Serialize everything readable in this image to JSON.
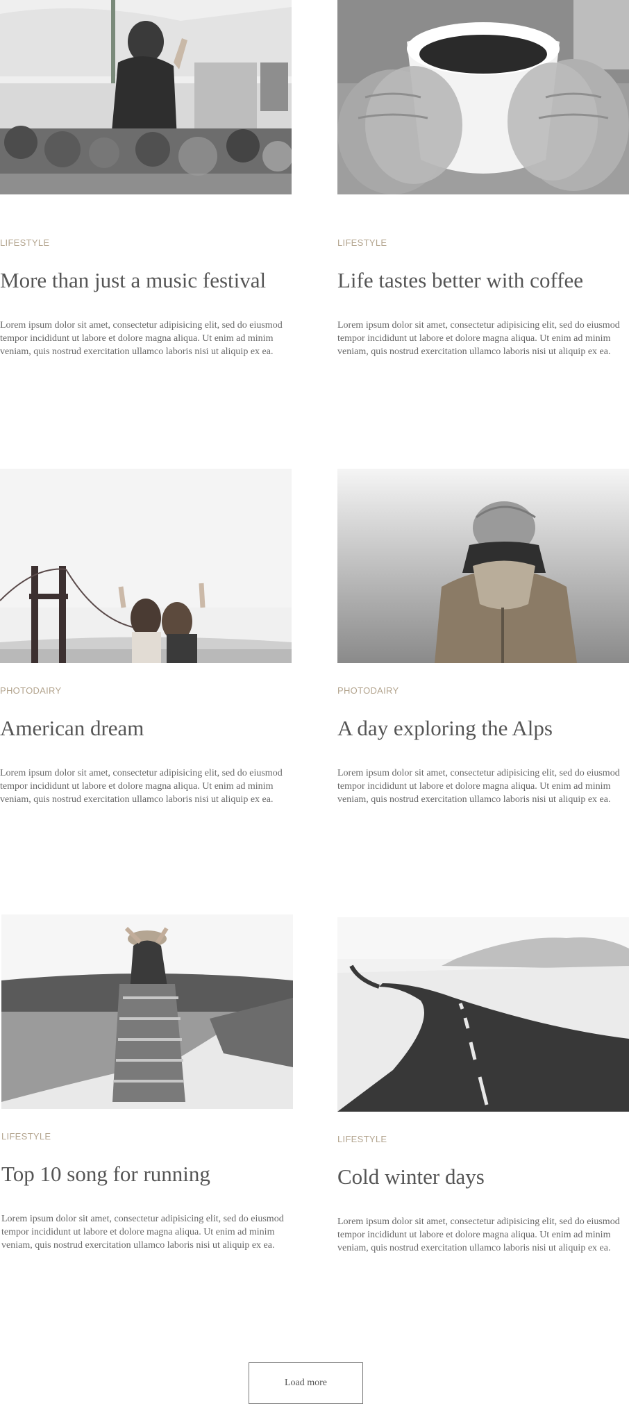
{
  "posts": [
    {
      "image": "concert-crowd-photo",
      "category": "LIFESTYLE",
      "title": "More than just a music festival",
      "excerpt": "Lorem ipsum dolor sit amet, consectetur adipisicing elit, sed do eiusmod tempor incididunt ut labore et dolore magna aliqua. Ut enim ad minim veniam, quis nostrud exercitation ullamco laboris nisi ut aliquip ex ea."
    },
    {
      "image": "coffee-cup-mittens-photo",
      "category": "LIFESTYLE",
      "title": "Life tastes better with coffee",
      "excerpt": "Lorem ipsum dolor sit amet, consectetur adipisicing elit, sed do eiusmod tempor incididunt ut labore et dolore magna aliqua. Ut enim ad minim veniam, quis nostrud exercitation ullamco laboris nisi ut aliquip ex ea."
    },
    {
      "image": "golden-gate-friends-photo",
      "category": "PHOTODAIRY",
      "title": "American dream",
      "excerpt": "Lorem ipsum dolor sit amet, consectetur adipisicing elit, sed do eiusmod tempor incididunt ut labore et dolore magna aliqua. Ut enim ad minim veniam, quis nostrud exercitation ullamco laboris nisi ut aliquip ex ea."
    },
    {
      "image": "hiker-beanie-fog-photo",
      "category": "PHOTODAIRY",
      "title": "A day exploring the Alps",
      "excerpt": "Lorem ipsum dolor sit amet, consectetur adipisicing elit, sed do eiusmod tempor incididunt ut labore et dolore magna aliqua. Ut enim ad minim veniam, quis nostrud exercitation ullamco laboris nisi ut aliquip ex ea."
    },
    {
      "image": "woman-hat-path-photo",
      "category": "LIFESTYLE",
      "title": "Top 10 song for running",
      "excerpt": "Lorem ipsum dolor sit amet, consectetur adipisicing elit, sed do eiusmod tempor incididunt ut labore et dolore magna aliqua. Ut enim ad minim veniam, quis nostrud exercitation ullamco laboris nisi ut aliquip ex ea."
    },
    {
      "image": "winter-road-photo",
      "category": "LIFESTYLE",
      "title": "Cold winter days",
      "excerpt": "Lorem ipsum dolor sit amet, consectetur adipisicing elit, sed do eiusmod tempor incididunt ut labore et dolore magna aliqua. Ut enim ad minim veniam, quis nostrud exercitation ullamco laboris nisi ut aliquip ex ea."
    }
  ],
  "load_more": {
    "label": "Load more"
  }
}
